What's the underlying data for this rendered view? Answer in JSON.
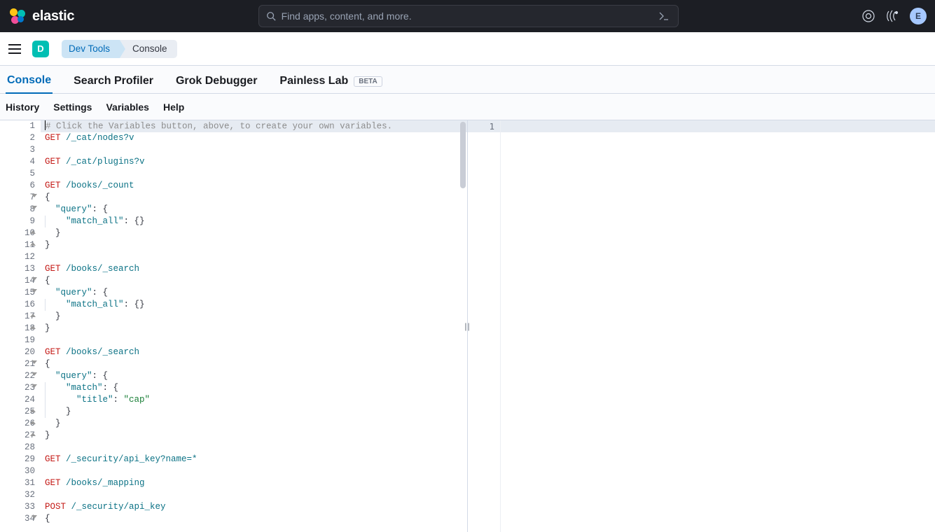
{
  "header": {
    "brand": "elastic",
    "search_placeholder": "Find apps, content, and more.",
    "avatar_initial": "E",
    "space_initial": "D"
  },
  "breadcrumb": {
    "first": "Dev Tools",
    "second": "Console"
  },
  "tabs": {
    "console": "Console",
    "profiler": "Search Profiler",
    "grok": "Grok Debugger",
    "painless": "Painless Lab",
    "beta": "BETA"
  },
  "menu": {
    "history": "History",
    "settings": "Settings",
    "variables": "Variables",
    "help": "Help"
  },
  "editor": {
    "lines": [
      {
        "n": "1",
        "fold": "",
        "type": "comment",
        "text": "# Click the Variables button, above, to create your own variables.",
        "hl": true
      },
      {
        "n": "2",
        "fold": "",
        "type": "req",
        "method": "GET",
        "url": "/_cat/nodes?v"
      },
      {
        "n": "3",
        "fold": "",
        "type": "blank"
      },
      {
        "n": "4",
        "fold": "",
        "type": "req",
        "method": "GET",
        "url": "/_cat/plugins?v"
      },
      {
        "n": "5",
        "fold": "",
        "type": "blank"
      },
      {
        "n": "6",
        "fold": "",
        "type": "req",
        "method": "GET",
        "url": "/books/_count"
      },
      {
        "n": "7",
        "fold": "open",
        "type": "brace",
        "text": "{"
      },
      {
        "n": "8",
        "fold": "open",
        "type": "kv",
        "indent": 1,
        "key": "\"query\"",
        "after": ": {"
      },
      {
        "n": "9",
        "fold": "",
        "type": "kv",
        "indent": 2,
        "guide": true,
        "key": "\"match_all\"",
        "after": ": {}"
      },
      {
        "n": "10",
        "fold": "close",
        "type": "brace",
        "indent": 1,
        "text": "}"
      },
      {
        "n": "11",
        "fold": "close",
        "type": "brace",
        "text": "}"
      },
      {
        "n": "12",
        "fold": "",
        "type": "blank"
      },
      {
        "n": "13",
        "fold": "",
        "type": "req",
        "method": "GET",
        "url": "/books/_search"
      },
      {
        "n": "14",
        "fold": "open",
        "type": "brace",
        "text": "{"
      },
      {
        "n": "15",
        "fold": "open",
        "type": "kv",
        "indent": 1,
        "key": "\"query\"",
        "after": ": {"
      },
      {
        "n": "16",
        "fold": "",
        "type": "kv",
        "indent": 2,
        "guide": true,
        "key": "\"match_all\"",
        "after": ": {}"
      },
      {
        "n": "17",
        "fold": "close",
        "type": "brace",
        "indent": 1,
        "text": "}"
      },
      {
        "n": "18",
        "fold": "close",
        "type": "brace",
        "text": "}"
      },
      {
        "n": "19",
        "fold": "",
        "type": "blank"
      },
      {
        "n": "20",
        "fold": "",
        "type": "req",
        "method": "GET",
        "url": "/books/_search"
      },
      {
        "n": "21",
        "fold": "open",
        "type": "brace",
        "text": "{"
      },
      {
        "n": "22",
        "fold": "open",
        "type": "kv",
        "indent": 1,
        "key": "\"query\"",
        "after": ": {"
      },
      {
        "n": "23",
        "fold": "open",
        "type": "kv",
        "indent": 2,
        "guide": true,
        "key": "\"match\"",
        "after": ": {"
      },
      {
        "n": "24",
        "fold": "",
        "type": "kvstr",
        "indent": 3,
        "guide": true,
        "key": "\"title\"",
        "str": "\"cap\""
      },
      {
        "n": "25",
        "fold": "close",
        "type": "brace",
        "indent": 2,
        "guide": true,
        "text": "}"
      },
      {
        "n": "26",
        "fold": "close",
        "type": "brace",
        "indent": 1,
        "text": "}"
      },
      {
        "n": "27",
        "fold": "close",
        "type": "brace",
        "text": "}"
      },
      {
        "n": "28",
        "fold": "",
        "type": "blank"
      },
      {
        "n": "29",
        "fold": "",
        "type": "req",
        "method": "GET",
        "url": "/_security/api_key?name=*"
      },
      {
        "n": "30",
        "fold": "",
        "type": "blank"
      },
      {
        "n": "31",
        "fold": "",
        "type": "req",
        "method": "GET",
        "url": "/books/_mapping"
      },
      {
        "n": "32",
        "fold": "",
        "type": "blank"
      },
      {
        "n": "33",
        "fold": "",
        "type": "req",
        "method": "POST",
        "url": "/_security/api_key"
      },
      {
        "n": "34",
        "fold": "open",
        "type": "brace",
        "text": "{"
      }
    ]
  },
  "output": {
    "line1": "1"
  }
}
